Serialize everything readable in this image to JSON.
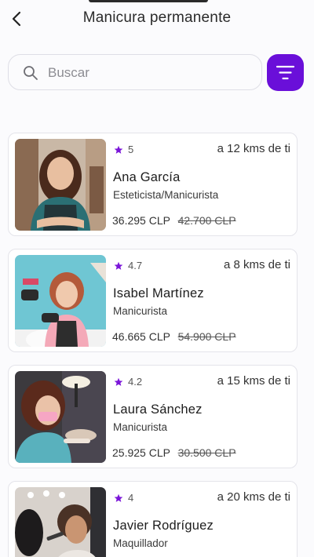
{
  "header": {
    "title": "Manicura permanente"
  },
  "search": {
    "placeholder": "Buscar",
    "value": ""
  },
  "theme": {
    "accent": "#6a0fd9",
    "star": "#7b16d9"
  },
  "professionals": [
    {
      "rating": "5",
      "distance": "a 12 kms de ti",
      "name": "Ana García",
      "role": "Esteticista/Manicurista",
      "price": "36.295 CLP",
      "old_price": "42.700 CLP"
    },
    {
      "rating": "4.7",
      "distance": "a 8 kms de ti",
      "name": "Isabel Martínez",
      "role": "Manicurista",
      "price": "46.665 CLP",
      "old_price": "54.900 CLP"
    },
    {
      "rating": "4.2",
      "distance": "a 15 kms de ti",
      "name": "Laura Sánchez",
      "role": "Manicurista",
      "price": "25.925 CLP",
      "old_price": "30.500 CLP"
    },
    {
      "rating": "4",
      "distance": "a 20 kms de ti",
      "name": "Javier Rodríguez",
      "role": "Maquillador",
      "price": "",
      "old_price": ""
    }
  ]
}
